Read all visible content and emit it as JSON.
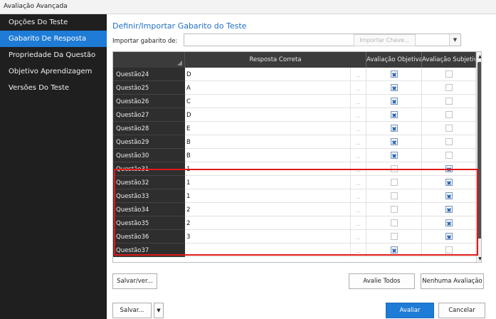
{
  "window": {
    "title": "Avaliação Avançada"
  },
  "sidebar": {
    "items": [
      {
        "label": "Opções Do Teste",
        "active": false
      },
      {
        "label": "Gabarito De Resposta",
        "active": true
      },
      {
        "label": "Propriedade Da Questão",
        "active": false
      },
      {
        "label": "Objetivo Aprendizagem",
        "active": false
      },
      {
        "label": "Versões Do Teste",
        "active": false
      }
    ]
  },
  "main": {
    "title": "Definir/Importar Gabarito do Teste",
    "import_label": "Importar gabarito de:",
    "import_value": "",
    "import_key_button": "Importar Chave..."
  },
  "grid": {
    "columns": {
      "answer": "Resposta Correta",
      "objective": "Avaliação Objetiva",
      "subjective": "Avaliação Subjetiva"
    },
    "ellipsis": "...",
    "rows": [
      {
        "question": "Questão24",
        "answer": "D",
        "objective": true,
        "subjective": false
      },
      {
        "question": "Questão25",
        "answer": "A",
        "objective": true,
        "subjective": false
      },
      {
        "question": "Questão26",
        "answer": "C",
        "objective": true,
        "subjective": false
      },
      {
        "question": "Questão27",
        "answer": "D",
        "objective": true,
        "subjective": false
      },
      {
        "question": "Questão28",
        "answer": "E",
        "objective": true,
        "subjective": false
      },
      {
        "question": "Questão29",
        "answer": "B",
        "objective": true,
        "subjective": false
      },
      {
        "question": "Questão30",
        "answer": "B",
        "objective": true,
        "subjective": false
      },
      {
        "question": "Questão31",
        "answer": "1",
        "objective": false,
        "subjective": true
      },
      {
        "question": "Questão32",
        "answer": "1",
        "objective": false,
        "subjective": true
      },
      {
        "question": "Questão33",
        "answer": "1",
        "objective": false,
        "subjective": true
      },
      {
        "question": "Questão34",
        "answer": "2",
        "objective": false,
        "subjective": true
      },
      {
        "question": "Questão35",
        "answer": "2",
        "objective": false,
        "subjective": true
      },
      {
        "question": "Questão36",
        "answer": "3",
        "objective": false,
        "subjective": true
      },
      {
        "question": "Questão37",
        "answer": "",
        "objective": true,
        "subjective": false
      }
    ]
  },
  "buttons": {
    "save_view": "Salvar/ver...",
    "evaluate_all": "Avalie Todos",
    "no_evaluation": "Nenhuma Avaliação",
    "save": "Salvar...",
    "evaluate": "Avaliar",
    "cancel": "Cancelar"
  },
  "colors": {
    "accent": "#1e7bd6",
    "highlight": "#e01919",
    "sidebar_bg": "#1f1f1f"
  }
}
